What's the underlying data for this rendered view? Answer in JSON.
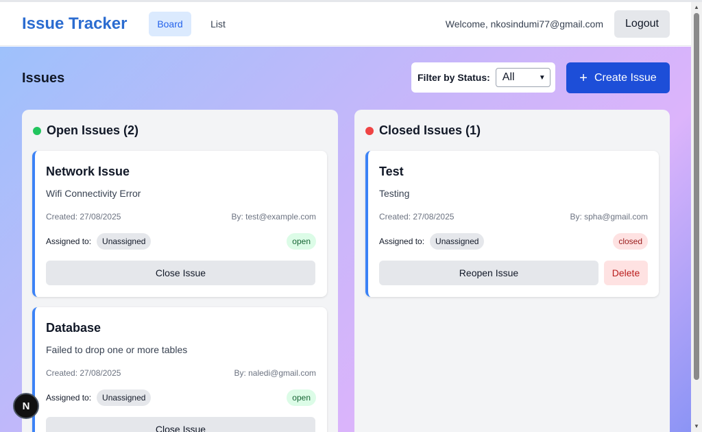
{
  "header": {
    "brand": "Issue Tracker",
    "nav": {
      "board": "Board",
      "list": "List"
    },
    "welcome": "Welcome, nkosindumi77@gmail.com",
    "logout": "Logout"
  },
  "main": {
    "title": "Issues",
    "filter": {
      "label": "Filter by Status:",
      "value": "All"
    },
    "create_button": "Create Issue"
  },
  "columns": {
    "open": {
      "title": "Open Issues (2)",
      "cards": [
        {
          "title": "Network Issue",
          "description": "Wifi Connectivity Error",
          "created": "Created: 27/08/2025",
          "by": "By: test@example.com",
          "assigned_label": "Assigned to:",
          "assignee": "Unassigned",
          "status": "open",
          "action": "Close Issue"
        },
        {
          "title": "Database",
          "description": "Failed to drop one or more tables",
          "created": "Created: 27/08/2025",
          "by": "By: naledi@gmail.com",
          "assigned_label": "Assigned to:",
          "assignee": "Unassigned",
          "status": "open",
          "action": "Close Issue"
        }
      ]
    },
    "closed": {
      "title": "Closed Issues (1)",
      "cards": [
        {
          "title": "Test",
          "description": "Testing",
          "created": "Created: 27/08/2025",
          "by": "By: spha@gmail.com",
          "assigned_label": "Assigned to:",
          "assignee": "Unassigned",
          "status": "closed",
          "action": "Reopen Issue",
          "delete": "Delete"
        }
      ]
    }
  },
  "badge": {
    "letter": "N"
  },
  "colors": {
    "brand": "#2b6cd0",
    "primary_button": "#1d4ed8",
    "open_dot": "#22c55e",
    "closed_dot": "#ef4444",
    "card_accent": "#3b82f6"
  }
}
